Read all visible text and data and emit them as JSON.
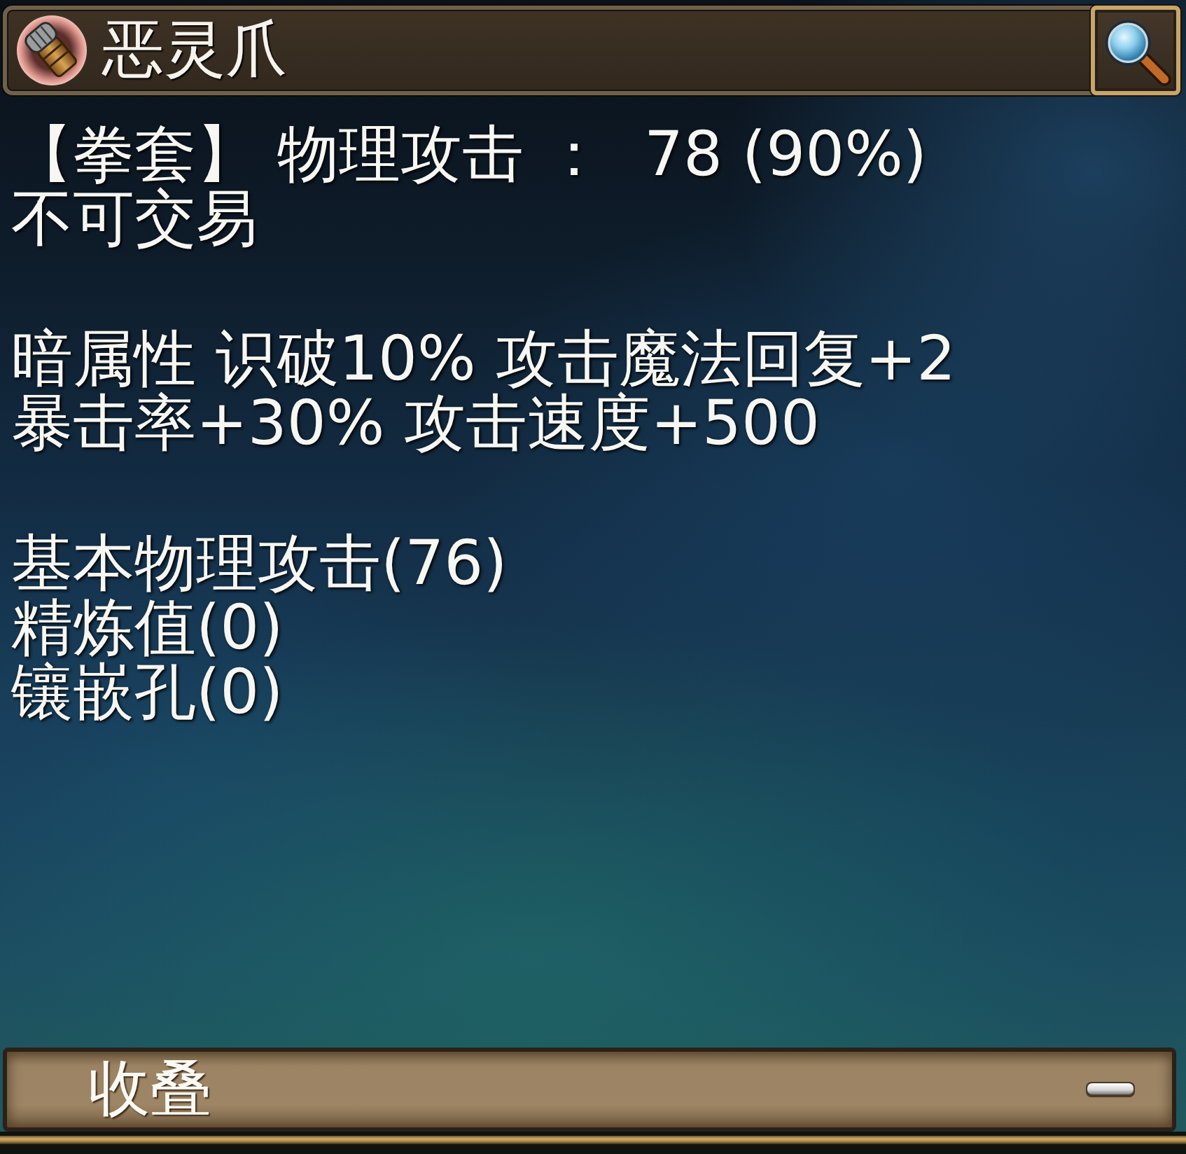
{
  "title_bar": {
    "title": "恶灵爪"
  },
  "sections": [
    {
      "lines": [
        "【拳套】 物理攻击 ：  78 (90%)",
        "不可交易"
      ]
    },
    {
      "lines": [
        "暗属性 识破10% 攻击魔法回复+2",
        "暴击率+30% 攻击速度+500"
      ]
    },
    {
      "lines": [
        "基本物理攻击(76)",
        "精炼值(0)",
        "镶嵌孔(0)"
      ]
    }
  ],
  "footer": {
    "label": "收叠"
  }
}
